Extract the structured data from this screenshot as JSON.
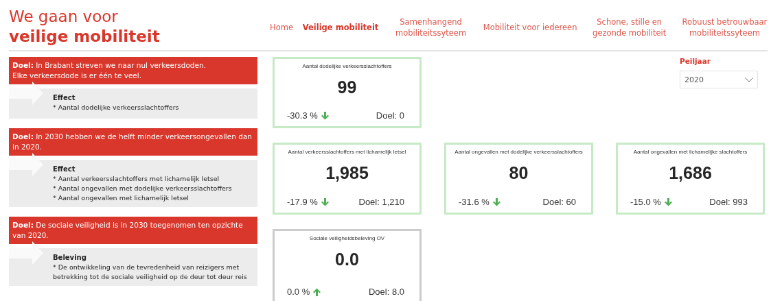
{
  "title": {
    "line_1": "We gaan voor",
    "line_2": "veilige mobiliteit"
  },
  "nav": [
    {
      "label": "Home",
      "selected": false
    },
    {
      "label": "Veilige mobiliteit",
      "selected": true
    },
    {
      "label": "Samenhangend mobiliteitssyteem",
      "selected": false
    },
    {
      "label": "Mobiliteit voor iedereen",
      "selected": false
    },
    {
      "label": "Schone, stille en gezonde mobiliteit",
      "selected": false
    },
    {
      "label": "Robuust betrouwbaar mobiliteitssyteem",
      "selected": false
    }
  ],
  "goals": [
    {
      "goal": "**Doel:** In Brabant streven we naar nul verkeersdoden.\nElke verkeersdode is er één te veel.",
      "heading": "Effect",
      "items": [
        "* Aantal dodelijke verkeersslachtoffers"
      ]
    },
    {
      "goal": "**Doel:** In 2030 hebben we de helft minder verkeersongevallen dan in 2020.",
      "heading": "Effect",
      "items": [
        "* Aantal verkeersslachtoffers met lichamelijk letsel",
        "* Aantal ongevallen met dodelijke verkeersslachtoffers",
        "* Aantal ongevallen met lichamelijk letsel"
      ]
    },
    {
      "goal": "**Doel:** De sociale veiligheid is in 2030 toegenomen ten opzichte van 2020.",
      "heading": "Beleving",
      "items": [
        "* De ontwikkeling van de tevredenheid van reizigers met betrekking tot de sociale veiligheid op de deur tot deur reis"
      ]
    }
  ],
  "filter": {
    "label": "Peiljaar",
    "value": "2020"
  },
  "kpi_rows": [
    [
      {
        "title": "Aantal dodelijke verkeersslachtoffers",
        "value": "99",
        "change": "-30.3 %",
        "kind": "down",
        "target": "Doel: 0",
        "color": "#c6e9c6"
      }
    ],
    [
      {
        "title": "Aantal verkeersslachtoffers met lichamelijk letsel",
        "value": "1,985",
        "change": "-17.9 %",
        "kind": "down",
        "target": "Doel: 1,210",
        "color": "#c6e9c6"
      },
      {
        "title": "Aantal ongevallen met dodelijke verkeersslachtoffers",
        "value": "80",
        "change": "-31.6 %",
        "kind": "down",
        "target": "Doel: 60",
        "color": "#c6e9c6"
      },
      {
        "title": "Aantal ongevallen met lichamelijke slachtoffers",
        "value": "1,686",
        "change": "-15.0 %",
        "kind": "down",
        "target": "Doel: 993",
        "color": "#c6e9c6"
      }
    ],
    [
      {
        "title": "Sociale veiligheidsbeleving OV",
        "value": "0.0",
        "change": "0.0 %",
        "kind": "up",
        "target": "Doel: 8.0",
        "color": "#cccccc"
      }
    ]
  ]
}
